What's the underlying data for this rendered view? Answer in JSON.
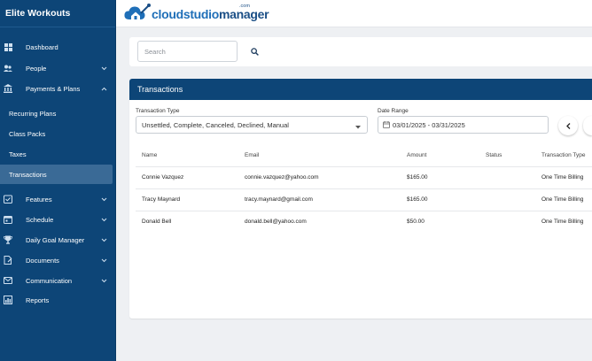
{
  "brand": "Elite Workouts",
  "logo": {
    "part1": "cloudstudio",
    "part2": "manager",
    "suffix": ".com"
  },
  "nav": [
    {
      "label": "Dashboard",
      "icon": "dashboard-icon",
      "chevron": ""
    },
    {
      "label": "People",
      "icon": "people-icon",
      "chevron": "down"
    },
    {
      "label": "Payments & Plans",
      "icon": "bank-icon",
      "chevron": "up"
    },
    {
      "label": "Recurring Plans",
      "sub": true
    },
    {
      "label": "Class Packs",
      "sub": true
    },
    {
      "label": "Taxes",
      "sub": true
    },
    {
      "label": "Transactions",
      "sub": true,
      "active": true
    },
    {
      "label": "Features",
      "icon": "features-icon",
      "chevron": "down"
    },
    {
      "label": "Schedule",
      "icon": "calendar-icon",
      "chevron": "down"
    },
    {
      "label": "Daily Goal Manager",
      "icon": "trophy-icon",
      "chevron": "down"
    },
    {
      "label": "Documents",
      "icon": "document-icon",
      "chevron": "down"
    },
    {
      "label": "Communication",
      "icon": "mail-icon",
      "chevron": "down"
    },
    {
      "label": "Reports",
      "icon": "reports-icon",
      "chevron": ""
    }
  ],
  "search": {
    "placeholder": "Search",
    "value": ""
  },
  "panel": {
    "title": "Transactions",
    "transaction_type_label": "Transaction Type",
    "transaction_type_value": "Unsettled, Complete, Canceled, Declined, Manual",
    "date_range_label": "Date Range",
    "date_range_value": "03/01/2025 - 03/31/2025"
  },
  "table": {
    "headers": [
      "Name",
      "Email",
      "Amount",
      "Status",
      "Transaction Type"
    ],
    "rows": [
      [
        "Connie Vazquez",
        "connie.vazquez@yahoo.com",
        "$165.00",
        "",
        "One Time Billing"
      ],
      [
        "Tracy Maynard",
        "tracy.maynard@gmail.com",
        "$165.00",
        "",
        "One Time Billing"
      ],
      [
        "Donald Bell",
        "donald.bell@yahoo.com",
        "$50.00",
        "",
        "One Time Billing"
      ]
    ]
  },
  "colors": {
    "sidebar": "#0d4577",
    "active_item": "#3a6a96",
    "panel_header": "#0d4577",
    "logo_primary": "#1f6fb8"
  }
}
